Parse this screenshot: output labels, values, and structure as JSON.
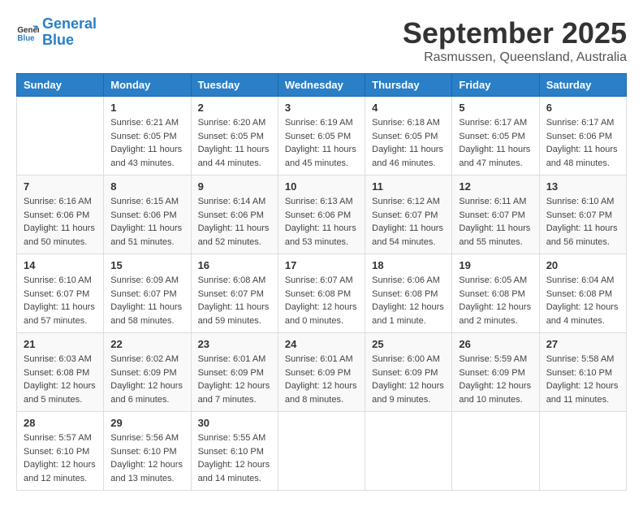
{
  "header": {
    "logo_general": "General",
    "logo_blue": "Blue",
    "month_title": "September 2025",
    "location": "Rasmussen, Queensland, Australia"
  },
  "days_of_week": [
    "Sunday",
    "Monday",
    "Tuesday",
    "Wednesday",
    "Thursday",
    "Friday",
    "Saturday"
  ],
  "weeks": [
    [
      {
        "day": "",
        "sunrise": "",
        "sunset": "",
        "daylight": ""
      },
      {
        "day": "1",
        "sunrise": "Sunrise: 6:21 AM",
        "sunset": "Sunset: 6:05 PM",
        "daylight": "Daylight: 11 hours and 43 minutes."
      },
      {
        "day": "2",
        "sunrise": "Sunrise: 6:20 AM",
        "sunset": "Sunset: 6:05 PM",
        "daylight": "Daylight: 11 hours and 44 minutes."
      },
      {
        "day": "3",
        "sunrise": "Sunrise: 6:19 AM",
        "sunset": "Sunset: 6:05 PM",
        "daylight": "Daylight: 11 hours and 45 minutes."
      },
      {
        "day": "4",
        "sunrise": "Sunrise: 6:18 AM",
        "sunset": "Sunset: 6:05 PM",
        "daylight": "Daylight: 11 hours and 46 minutes."
      },
      {
        "day": "5",
        "sunrise": "Sunrise: 6:17 AM",
        "sunset": "Sunset: 6:05 PM",
        "daylight": "Daylight: 11 hours and 47 minutes."
      },
      {
        "day": "6",
        "sunrise": "Sunrise: 6:17 AM",
        "sunset": "Sunset: 6:06 PM",
        "daylight": "Daylight: 11 hours and 48 minutes."
      }
    ],
    [
      {
        "day": "7",
        "sunrise": "Sunrise: 6:16 AM",
        "sunset": "Sunset: 6:06 PM",
        "daylight": "Daylight: 11 hours and 50 minutes."
      },
      {
        "day": "8",
        "sunrise": "Sunrise: 6:15 AM",
        "sunset": "Sunset: 6:06 PM",
        "daylight": "Daylight: 11 hours and 51 minutes."
      },
      {
        "day": "9",
        "sunrise": "Sunrise: 6:14 AM",
        "sunset": "Sunset: 6:06 PM",
        "daylight": "Daylight: 11 hours and 52 minutes."
      },
      {
        "day": "10",
        "sunrise": "Sunrise: 6:13 AM",
        "sunset": "Sunset: 6:06 PM",
        "daylight": "Daylight: 11 hours and 53 minutes."
      },
      {
        "day": "11",
        "sunrise": "Sunrise: 6:12 AM",
        "sunset": "Sunset: 6:07 PM",
        "daylight": "Daylight: 11 hours and 54 minutes."
      },
      {
        "day": "12",
        "sunrise": "Sunrise: 6:11 AM",
        "sunset": "Sunset: 6:07 PM",
        "daylight": "Daylight: 11 hours and 55 minutes."
      },
      {
        "day": "13",
        "sunrise": "Sunrise: 6:10 AM",
        "sunset": "Sunset: 6:07 PM",
        "daylight": "Daylight: 11 hours and 56 minutes."
      }
    ],
    [
      {
        "day": "14",
        "sunrise": "Sunrise: 6:10 AM",
        "sunset": "Sunset: 6:07 PM",
        "daylight": "Daylight: 11 hours and 57 minutes."
      },
      {
        "day": "15",
        "sunrise": "Sunrise: 6:09 AM",
        "sunset": "Sunset: 6:07 PM",
        "daylight": "Daylight: 11 hours and 58 minutes."
      },
      {
        "day": "16",
        "sunrise": "Sunrise: 6:08 AM",
        "sunset": "Sunset: 6:07 PM",
        "daylight": "Daylight: 11 hours and 59 minutes."
      },
      {
        "day": "17",
        "sunrise": "Sunrise: 6:07 AM",
        "sunset": "Sunset: 6:08 PM",
        "daylight": "Daylight: 12 hours and 0 minutes."
      },
      {
        "day": "18",
        "sunrise": "Sunrise: 6:06 AM",
        "sunset": "Sunset: 6:08 PM",
        "daylight": "Daylight: 12 hours and 1 minute."
      },
      {
        "day": "19",
        "sunrise": "Sunrise: 6:05 AM",
        "sunset": "Sunset: 6:08 PM",
        "daylight": "Daylight: 12 hours and 2 minutes."
      },
      {
        "day": "20",
        "sunrise": "Sunrise: 6:04 AM",
        "sunset": "Sunset: 6:08 PM",
        "daylight": "Daylight: 12 hours and 4 minutes."
      }
    ],
    [
      {
        "day": "21",
        "sunrise": "Sunrise: 6:03 AM",
        "sunset": "Sunset: 6:08 PM",
        "daylight": "Daylight: 12 hours and 5 minutes."
      },
      {
        "day": "22",
        "sunrise": "Sunrise: 6:02 AM",
        "sunset": "Sunset: 6:09 PM",
        "daylight": "Daylight: 12 hours and 6 minutes."
      },
      {
        "day": "23",
        "sunrise": "Sunrise: 6:01 AM",
        "sunset": "Sunset: 6:09 PM",
        "daylight": "Daylight: 12 hours and 7 minutes."
      },
      {
        "day": "24",
        "sunrise": "Sunrise: 6:01 AM",
        "sunset": "Sunset: 6:09 PM",
        "daylight": "Daylight: 12 hours and 8 minutes."
      },
      {
        "day": "25",
        "sunrise": "Sunrise: 6:00 AM",
        "sunset": "Sunset: 6:09 PM",
        "daylight": "Daylight: 12 hours and 9 minutes."
      },
      {
        "day": "26",
        "sunrise": "Sunrise: 5:59 AM",
        "sunset": "Sunset: 6:09 PM",
        "daylight": "Daylight: 12 hours and 10 minutes."
      },
      {
        "day": "27",
        "sunrise": "Sunrise: 5:58 AM",
        "sunset": "Sunset: 6:10 PM",
        "daylight": "Daylight: 12 hours and 11 minutes."
      }
    ],
    [
      {
        "day": "28",
        "sunrise": "Sunrise: 5:57 AM",
        "sunset": "Sunset: 6:10 PM",
        "daylight": "Daylight: 12 hours and 12 minutes."
      },
      {
        "day": "29",
        "sunrise": "Sunrise: 5:56 AM",
        "sunset": "Sunset: 6:10 PM",
        "daylight": "Daylight: 12 hours and 13 minutes."
      },
      {
        "day": "30",
        "sunrise": "Sunrise: 5:55 AM",
        "sunset": "Sunset: 6:10 PM",
        "daylight": "Daylight: 12 hours and 14 minutes."
      },
      {
        "day": "",
        "sunrise": "",
        "sunset": "",
        "daylight": ""
      },
      {
        "day": "",
        "sunrise": "",
        "sunset": "",
        "daylight": ""
      },
      {
        "day": "",
        "sunrise": "",
        "sunset": "",
        "daylight": ""
      },
      {
        "day": "",
        "sunrise": "",
        "sunset": "",
        "daylight": ""
      }
    ]
  ]
}
